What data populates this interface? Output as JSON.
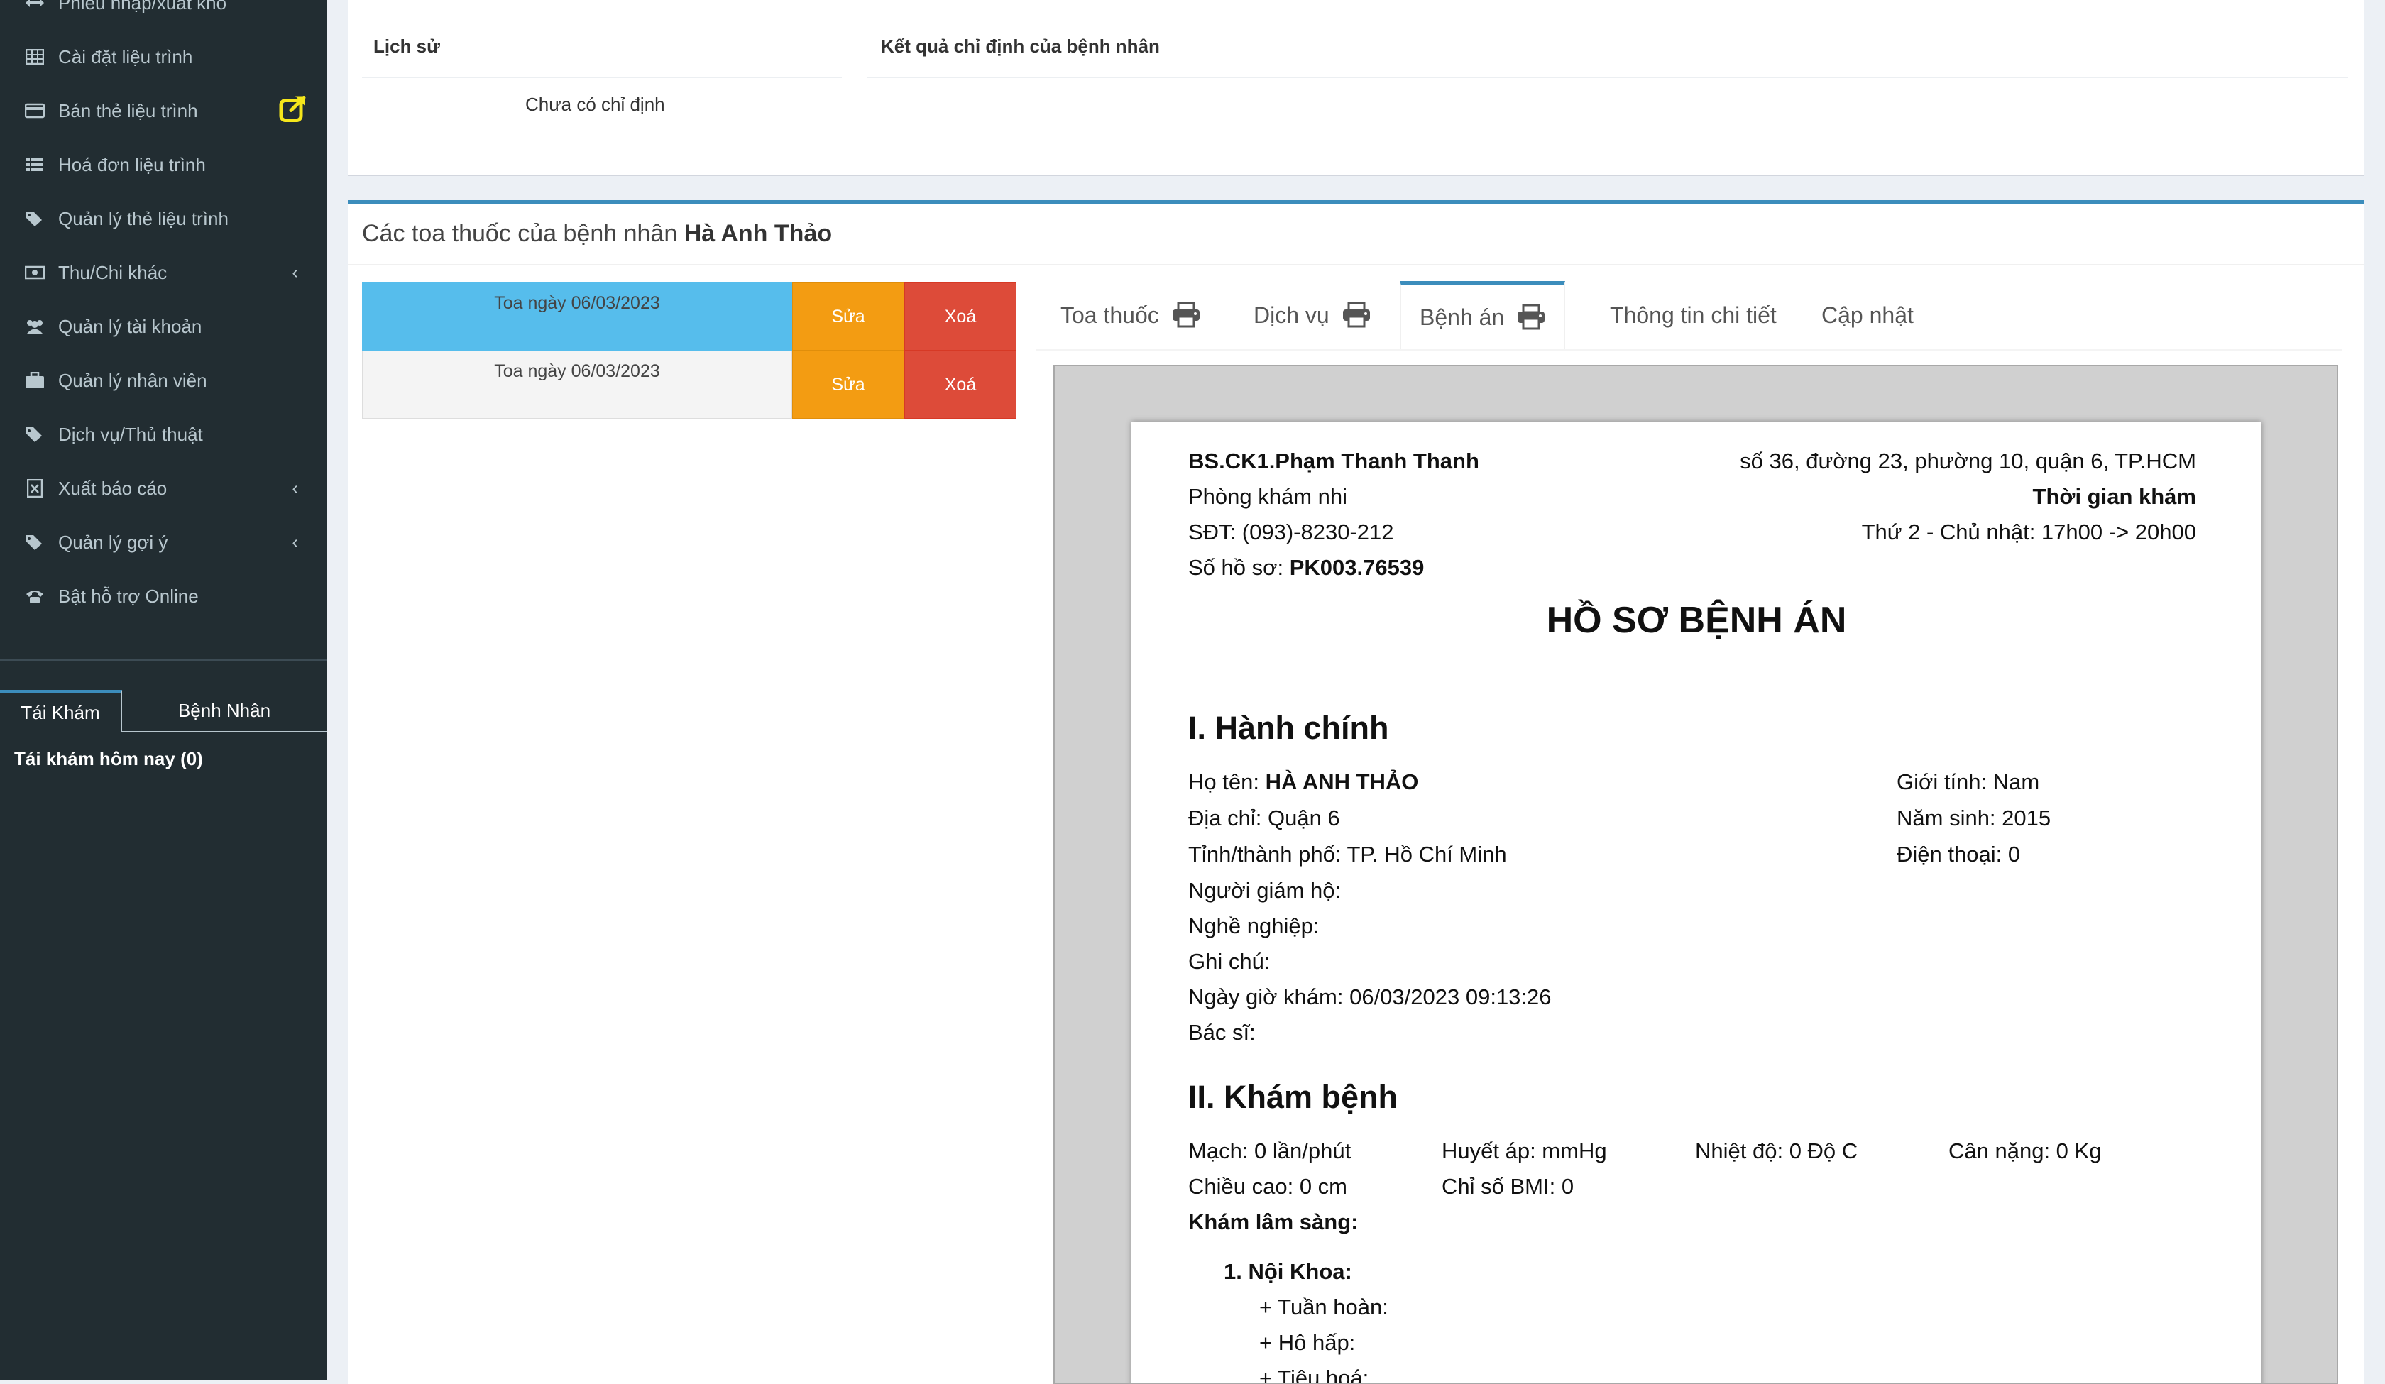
{
  "sidebar": {
    "menu": [
      {
        "label": "Phiếu nhập/xuất kho",
        "icon": "arrows-h-icon"
      },
      {
        "label": "Cài đặt liệu trình",
        "icon": "table-icon"
      },
      {
        "label": "Bán thẻ liệu trình",
        "icon": "credit-card-icon",
        "extra": "external-link-icon"
      },
      {
        "label": "Hoá đơn liệu trình",
        "icon": "list-icon"
      },
      {
        "label": "Quản lý thẻ liệu trình",
        "icon": "tags-icon"
      },
      {
        "label": "Thu/Chi khác",
        "icon": "money-icon",
        "chevron": true
      },
      {
        "label": "Quản lý tài khoản",
        "icon": "users-icon"
      },
      {
        "label": "Quản lý nhân viên",
        "icon": "briefcase-icon"
      },
      {
        "label": "Dịch vụ/Thủ thuật",
        "icon": "tags-icon"
      },
      {
        "label": "Xuất báo cáo",
        "icon": "file-excel-icon",
        "chevron": true
      },
      {
        "label": "Quản lý gợi ý",
        "icon": "tags-icon",
        "chevron": true
      },
      {
        "label": "Bật hỗ trợ Online",
        "icon": "phone-icon"
      }
    ],
    "tabs": [
      "Tái Khám",
      "Bệnh Nhân"
    ],
    "today_label": "Tái khám hôm nay (0)",
    "accent_color": "#f5e61b"
  },
  "top_box": {
    "col_history": "Lịch sử",
    "col_results": "Kết quả chỉ định của bệnh nhân",
    "empty_history": "Chưa có chỉ định"
  },
  "prescriptions": {
    "title_prefix": "Các toa thuốc của bệnh nhân",
    "patient_name": "Hà Anh Thảo",
    "rows": [
      {
        "label": "Toa ngày 06/03/2023",
        "edit": "Sửa",
        "delete": "Xoá",
        "selected": true
      },
      {
        "label": "Toa ngày 06/03/2023",
        "edit": "Sửa",
        "delete": "Xoá",
        "selected": false
      }
    ],
    "selected_color": "#56bdec",
    "unselected_color": "#f4f4f4"
  },
  "tabs": [
    {
      "label": "Toa thuốc",
      "icon": "print-icon"
    },
    {
      "label": "Dịch vụ",
      "icon": "print-icon"
    },
    {
      "label": "Bệnh án",
      "icon": "print-icon",
      "active": true
    },
    {
      "label": "Thông tin chi tiết"
    },
    {
      "label": "Cập nhật"
    }
  ],
  "document": {
    "doctor": "BS.CK1.Phạm Thanh Thanh",
    "clinic": "Phòng khám nhi",
    "phone": "SĐT: (093)-8230-212",
    "record_label": "Số hồ sơ:",
    "record_no": "PK003.76539",
    "address": "số 36, đường 23, phường 10, quận 6, TP.HCM",
    "hours_title": "Thời gian khám",
    "hours": "Thứ 2 - Chủ nhật: 17h00 -> 20h00",
    "title": "HỒ SƠ BỆNH ÁN",
    "admin": {
      "heading": "I. Hành chính",
      "name_label": "Họ tên:",
      "name": "HÀ ANH THẢO",
      "address": "Địa chỉ: Quận 6",
      "city": "Tỉnh/thành phố: TP. Hồ Chí Minh",
      "guardian": "Người giám hộ:",
      "job": "Nghề nghiệp:",
      "note": "Ghi chú:",
      "visit_time": "Ngày giờ khám: 06/03/2023 09:13:26",
      "doctor": "Bác sĩ:",
      "gender": "Giới tính: Nam",
      "birth_year": "Năm sinh: 2015",
      "tel": "Điện thoại: 0"
    },
    "exam": {
      "heading": "II. Khám bệnh",
      "pulse": "Mạch: 0 lần/phút",
      "bp": "Huyết áp: mmHg",
      "temp": "Nhiệt độ: 0 Độ C",
      "weight": "Cân nặng: 0 Kg",
      "height": "Chiều cao: 0 cm",
      "bmi": "Chỉ số BMI: 0",
      "clinical": "Khám lâm sàng:",
      "internal": "1. Nội Khoa:",
      "circulation": "+ Tuần hoàn:",
      "respiration": "+ Hô hấp:",
      "digestion": "+ Tiêu hoá:"
    }
  }
}
